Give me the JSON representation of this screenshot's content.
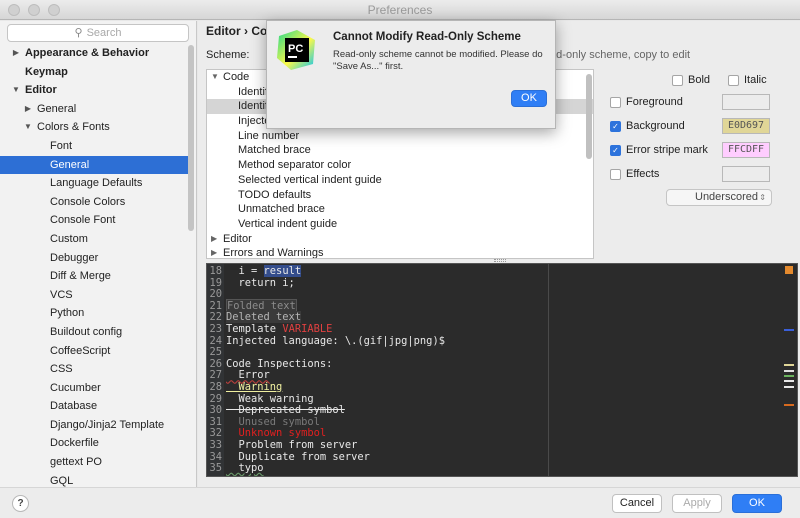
{
  "window": {
    "title": "Preferences"
  },
  "sidebar": {
    "search_placeholder": "Search",
    "items": [
      {
        "label": "Appearance & Behavior",
        "level": 0,
        "arrow": "▶",
        "bold": true
      },
      {
        "label": "Keymap",
        "level": 0,
        "arrow": "",
        "bold": true
      },
      {
        "label": "Editor",
        "level": 0,
        "arrow": "▼",
        "bold": true
      },
      {
        "label": "General",
        "level": 1,
        "arrow": "▶"
      },
      {
        "label": "Colors & Fonts",
        "level": 1,
        "arrow": "▼"
      },
      {
        "label": "Font",
        "level": 2,
        "arrow": ""
      },
      {
        "label": "General",
        "level": 2,
        "arrow": "",
        "selected": true
      },
      {
        "label": "Language Defaults",
        "level": 2,
        "arrow": ""
      },
      {
        "label": "Console Colors",
        "level": 2,
        "arrow": ""
      },
      {
        "label": "Console Font",
        "level": 2,
        "arrow": ""
      },
      {
        "label": "Custom",
        "level": 2,
        "arrow": ""
      },
      {
        "label": "Debugger",
        "level": 2,
        "arrow": ""
      },
      {
        "label": "Diff & Merge",
        "level": 2,
        "arrow": ""
      },
      {
        "label": "VCS",
        "level": 2,
        "arrow": ""
      },
      {
        "label": "Python",
        "level": 2,
        "arrow": ""
      },
      {
        "label": "Buildout config",
        "level": 2,
        "arrow": ""
      },
      {
        "label": "CoffeeScript",
        "level": 2,
        "arrow": ""
      },
      {
        "label": "CSS",
        "level": 2,
        "arrow": ""
      },
      {
        "label": "Cucumber",
        "level": 2,
        "arrow": ""
      },
      {
        "label": "Database",
        "level": 2,
        "arrow": ""
      },
      {
        "label": "Django/Jinja2 Template",
        "level": 2,
        "arrow": ""
      },
      {
        "label": "Dockerfile",
        "level": 2,
        "arrow": ""
      },
      {
        "label": "gettext PO",
        "level": 2,
        "arrow": ""
      },
      {
        "label": "GQL",
        "level": 2,
        "arrow": ""
      }
    ]
  },
  "main": {
    "breadcrumb": "Editor › Colors & Fonts › General",
    "scheme_label": "Scheme:",
    "scheme_hint": "Read-only scheme, copy to edit",
    "color_tree": [
      {
        "label": "Code",
        "arrow": "▼",
        "indent": 0
      },
      {
        "label": "Identifier under caret",
        "arrow": "",
        "indent": 1
      },
      {
        "label": "Identifier under caret (write)",
        "arrow": "",
        "indent": 1,
        "highlight": true
      },
      {
        "label": "Injected language fragment",
        "arrow": "",
        "indent": 1
      },
      {
        "label": "Line number",
        "arrow": "",
        "indent": 1
      },
      {
        "label": "Matched brace",
        "arrow": "",
        "indent": 1
      },
      {
        "label": "Method separator color",
        "arrow": "",
        "indent": 1
      },
      {
        "label": "Selected vertical indent guide",
        "arrow": "",
        "indent": 1
      },
      {
        "label": "TODO defaults",
        "arrow": "",
        "indent": 1
      },
      {
        "label": "Unmatched brace",
        "arrow": "",
        "indent": 1
      },
      {
        "label": "Vertical indent guide",
        "arrow": "",
        "indent": 1
      },
      {
        "label": "Editor",
        "arrow": "▶",
        "indent": 0
      },
      {
        "label": "Errors and Warnings",
        "arrow": "▶",
        "indent": 0
      }
    ],
    "options": {
      "bold": {
        "label": "Bold",
        "checked": false
      },
      "italic": {
        "label": "Italic",
        "checked": false
      },
      "foreground": {
        "label": "Foreground",
        "checked": false,
        "value": ""
      },
      "background": {
        "label": "Background",
        "checked": true,
        "value": "E0D697"
      },
      "error_stripe": {
        "label": "Error stripe mark",
        "checked": true,
        "value": "FFCDFF"
      },
      "effects": {
        "label": "Effects",
        "checked": false,
        "value": ""
      },
      "effect_type": "Underscored"
    },
    "code_lines": [
      {
        "n": "18",
        "text": "  i = result"
      },
      {
        "n": "19",
        "text": "  return i;"
      },
      {
        "n": "20",
        "text": ""
      },
      {
        "n": "21",
        "text": "Folded text"
      },
      {
        "n": "22",
        "text": "Deleted text"
      },
      {
        "n": "23",
        "text": "Template VARIABLE"
      },
      {
        "n": "24",
        "text": "Injected language: \\.(gif|jpg|png)$"
      },
      {
        "n": "25",
        "text": ""
      },
      {
        "n": "26",
        "text": "Code Inspections:"
      },
      {
        "n": "27",
        "text": "  Error"
      },
      {
        "n": "28",
        "text": "  Warning"
      },
      {
        "n": "29",
        "text": "  Weak warning"
      },
      {
        "n": "30",
        "text": "  Deprecated symbol"
      },
      {
        "n": "31",
        "text": "  Unused symbol"
      },
      {
        "n": "32",
        "text": "  Unknown symbol"
      },
      {
        "n": "33",
        "text": "  Problem from server"
      },
      {
        "n": "34",
        "text": "  Duplicate from server"
      },
      {
        "n": "35",
        "text": "  typo"
      }
    ]
  },
  "buttons": {
    "help": "?",
    "cancel": "Cancel",
    "apply": "Apply",
    "ok": "OK"
  },
  "dialog": {
    "title": "Cannot Modify Read-Only Scheme",
    "message": "Read-only scheme cannot be modified. Please do \"Save As...\" first.",
    "ok": "OK",
    "logo_text": "PC"
  },
  "colors": {
    "selection": "#2d6fd5",
    "primary_button": "#2f7ef5",
    "editor_bg": "#2b2b2b",
    "background_swatch": "#E0D697",
    "error_stripe_swatch": "#FFCDFF"
  }
}
